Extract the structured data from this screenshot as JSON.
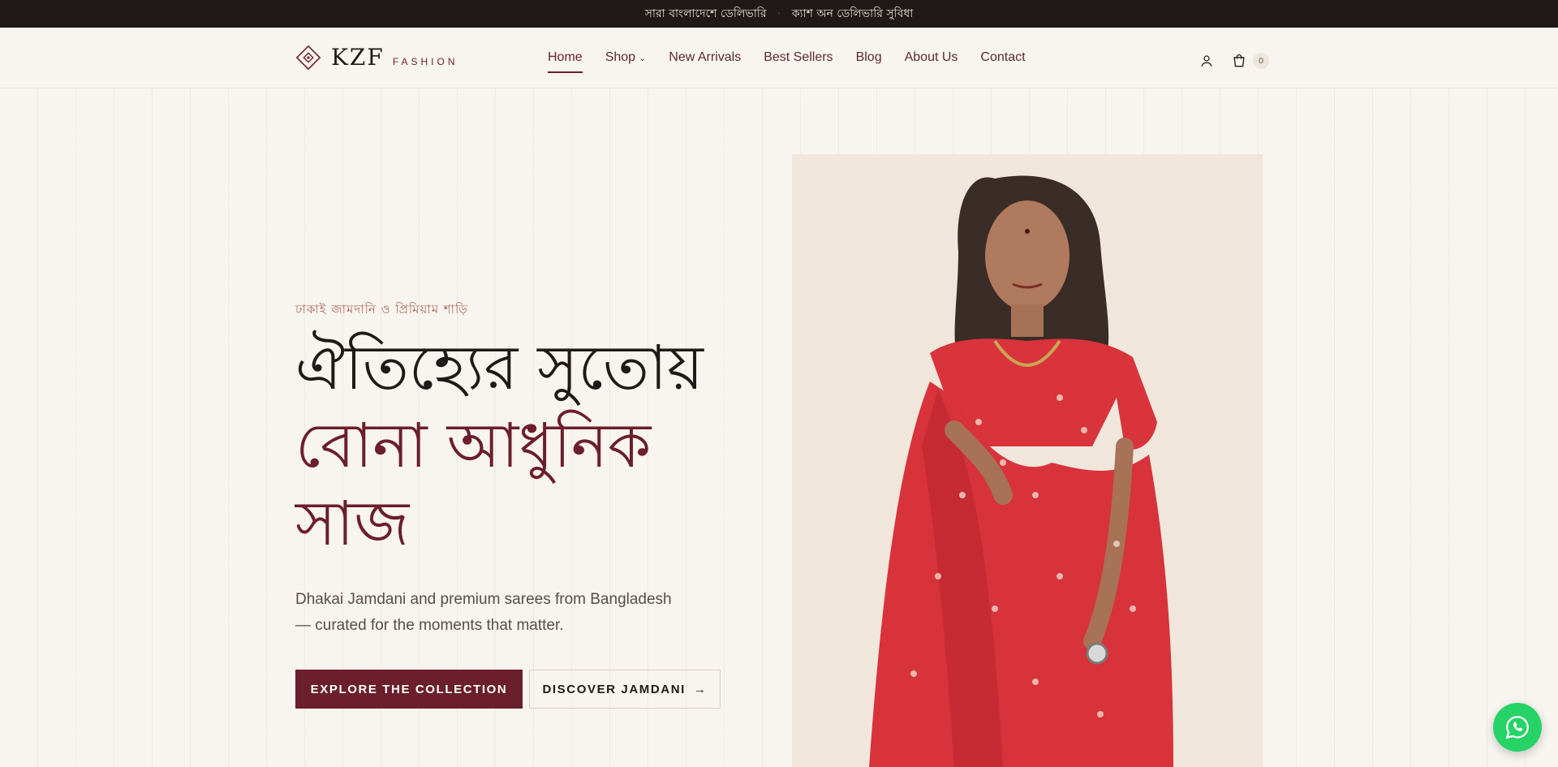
{
  "topbar": {
    "message_1": "সারা বাংলাদেশে ডেলিভারি",
    "separator": "·",
    "message_2": "ক্যাশ অন ডেলিভারি সুবিধা"
  },
  "brand": {
    "name": "KZF",
    "sub": "FASHION",
    "accent_color": "#6b1e2b"
  },
  "nav": {
    "items": [
      {
        "label": "Home",
        "active": true
      },
      {
        "label": "Shop",
        "has_dropdown": true
      },
      {
        "label": "New Arrivals"
      },
      {
        "label": "Best Sellers"
      },
      {
        "label": "Blog"
      },
      {
        "label": "About Us"
      },
      {
        "label": "Contact"
      }
    ]
  },
  "header_icons": {
    "account_icon": "user-icon",
    "cart_icon": "shopping-bag-icon",
    "cart_count": "0"
  },
  "hero": {
    "eyebrow": "ঢাকাই জামদানি ও প্রিমিয়াম শাড়ি",
    "headline_line1": "ঐতিহ্যের সুতোয়",
    "headline_line2": "বোনা আধুনিক সাজ",
    "lead": "Dhakai Jamdani and premium sarees from Bangladesh — curated for the moments that matter.",
    "cta_primary": "EXPLORE THE COLLECTION",
    "cta_secondary": "DISCOVER JAMDANI",
    "cta_secondary_icon": "arrow-right-icon"
  },
  "floating": {
    "whatsapp_icon": "whatsapp-icon"
  }
}
